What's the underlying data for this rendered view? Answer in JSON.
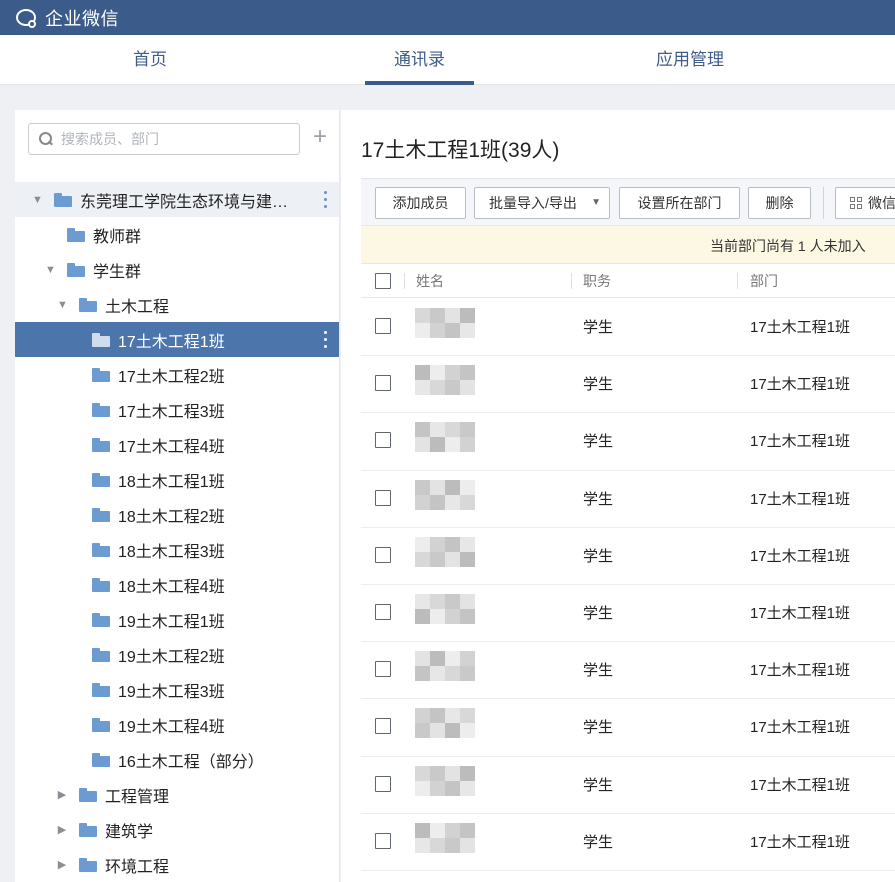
{
  "app": {
    "brand": "企业微信"
  },
  "nav": {
    "tabs": [
      {
        "label": "首页"
      },
      {
        "label": "通讯录"
      },
      {
        "label": "应用管理"
      }
    ],
    "active": "通讯录"
  },
  "sidebar": {
    "search_placeholder": "搜索成员、部门",
    "add_icon": "plus-icon",
    "tree": [
      {
        "label": "东莞理工学院生态环境与建…",
        "level": 0,
        "expanded": true
      },
      {
        "label": "教师群",
        "level": 1
      },
      {
        "label": "学生群",
        "level": 1,
        "expanded": true
      },
      {
        "label": "土木工程",
        "level": 2,
        "expanded": true
      },
      {
        "label": "17土木工程1班",
        "level": 3,
        "selected": true
      },
      {
        "label": "17土木工程2班",
        "level": 3
      },
      {
        "label": "17土木工程3班",
        "level": 3
      },
      {
        "label": "17土木工程4班",
        "level": 3
      },
      {
        "label": "18土木工程1班",
        "level": 3
      },
      {
        "label": "18土木工程2班",
        "level": 3
      },
      {
        "label": "18土木工程3班",
        "level": 3
      },
      {
        "label": "18土木工程4班",
        "level": 3
      },
      {
        "label": "19土木工程1班",
        "level": 3
      },
      {
        "label": "19土木工程2班",
        "level": 3
      },
      {
        "label": "19土木工程3班",
        "level": 3
      },
      {
        "label": "19土木工程4班",
        "level": 3
      },
      {
        "label": "16土木工程（部分）",
        "level": 3
      },
      {
        "label": "工程管理",
        "level": 2,
        "collapsed": true
      },
      {
        "label": "建筑学",
        "level": 2,
        "collapsed": true
      },
      {
        "label": "环境工程",
        "level": 2,
        "collapsed": true
      }
    ]
  },
  "main": {
    "title": "17土木工程1班(39人)",
    "toolbar": {
      "add_member": "添加成员",
      "batch_import": "批量导入/导出",
      "set_dept": "设置所在部门",
      "delete": "删除",
      "wechat": "微信"
    },
    "notice": "当前部门尚有 1 人未加入",
    "columns": {
      "name": "姓名",
      "role": "职务",
      "dept": "部门"
    },
    "rows": [
      {
        "role": "学生",
        "dept": "17土木工程1班"
      },
      {
        "role": "学生",
        "dept": "17土木工程1班"
      },
      {
        "role": "学生",
        "dept": "17土木工程1班"
      },
      {
        "role": "学生",
        "dept": "17土木工程1班"
      },
      {
        "role": "学生",
        "dept": "17土木工程1班"
      },
      {
        "role": "学生",
        "dept": "17土木工程1班"
      },
      {
        "role": "学生",
        "dept": "17土木工程1班"
      },
      {
        "role": "学生",
        "dept": "17土木工程1班"
      },
      {
        "role": "学生",
        "dept": "17土木工程1班"
      },
      {
        "role": "学生",
        "dept": "17土木工程1班"
      }
    ]
  }
}
